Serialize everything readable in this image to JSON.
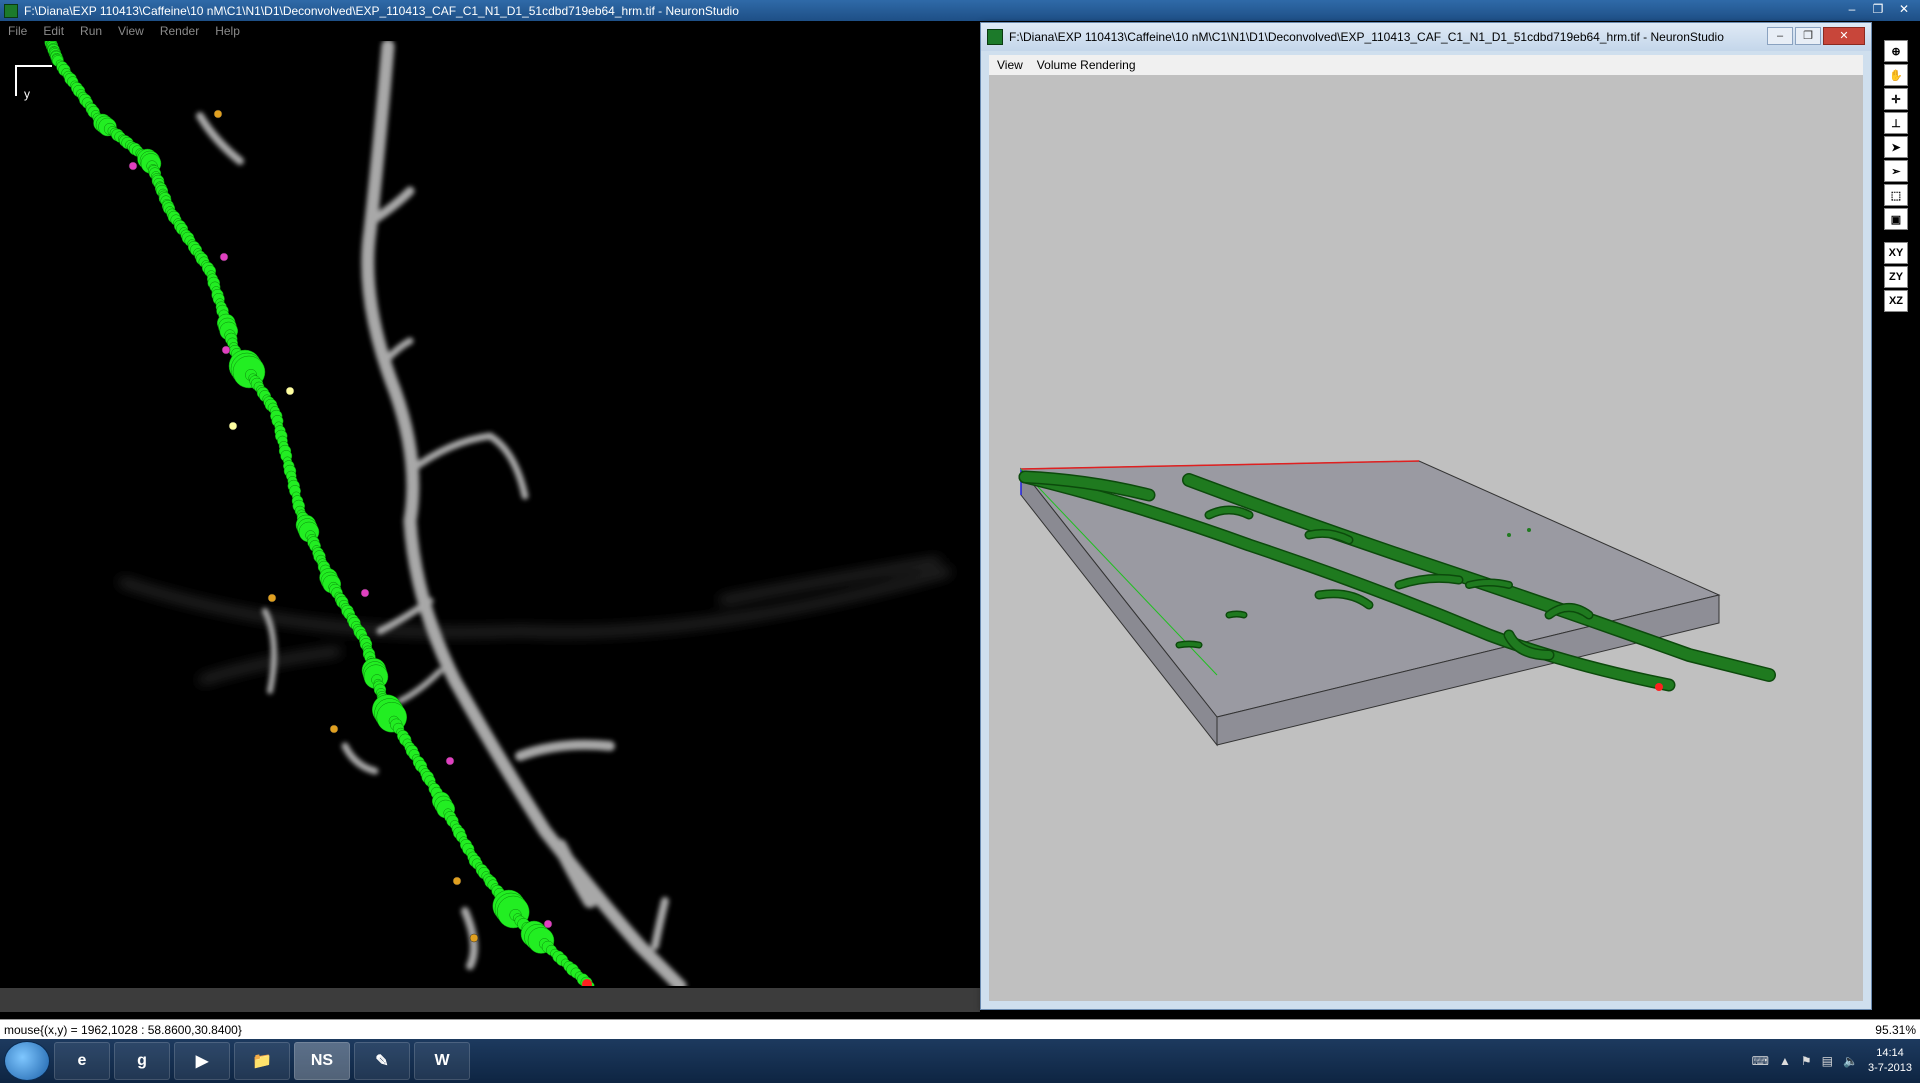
{
  "app": {
    "title": "F:\\Diana\\EXP 110413\\Caffeine\\10 nM\\C1\\N1\\D1\\Deconvolved\\EXP_110413_CAF_C1_N1_D1_51cdbd719eb64_hrm.tif - NeuronStudio",
    "menu": [
      "File",
      "Edit",
      "Run",
      "View",
      "Render",
      "Help"
    ],
    "window_controls": [
      "–",
      "❐",
      "✕"
    ]
  },
  "viewer2d": {
    "axis_label": "y"
  },
  "window3d": {
    "title": "F:\\Diana\\EXP 110413\\Caffeine\\10 nM\\C1\\N1\\D1\\Deconvolved\\EXP_110413_CAF_C1_N1_D1_51cdbd719eb64_hrm.tif - NeuronStudio",
    "menu": [
      "View",
      "Volume Rendering"
    ],
    "controls": [
      "–",
      "❐",
      "✕"
    ]
  },
  "toolbar": {
    "tools": [
      "zoom-icon",
      "hand-icon",
      "crosshair-icon",
      "ruler-icon",
      "pointer-icon",
      "pointer-edit-icon",
      "select-region-icon",
      "lock-icon"
    ],
    "planes": [
      "XY",
      "ZY",
      "XZ"
    ]
  },
  "status": {
    "mouse": "mouse{(x,y) = 1962,1028 : 58.8600,30.8400}",
    "zoom": "95.31%"
  },
  "taskbar": {
    "apps": [
      "e",
      "g",
      "▶",
      "📁",
      "NS",
      "✎",
      "W"
    ],
    "time": "14:14",
    "date": "3-7-2013"
  },
  "colors": {
    "trace": "#22ee22",
    "spine_orange": "#e0a020",
    "spine_magenta": "#e040c0",
    "endpoint_red": "#ff2020",
    "volume_green": "#1f7a1f"
  }
}
